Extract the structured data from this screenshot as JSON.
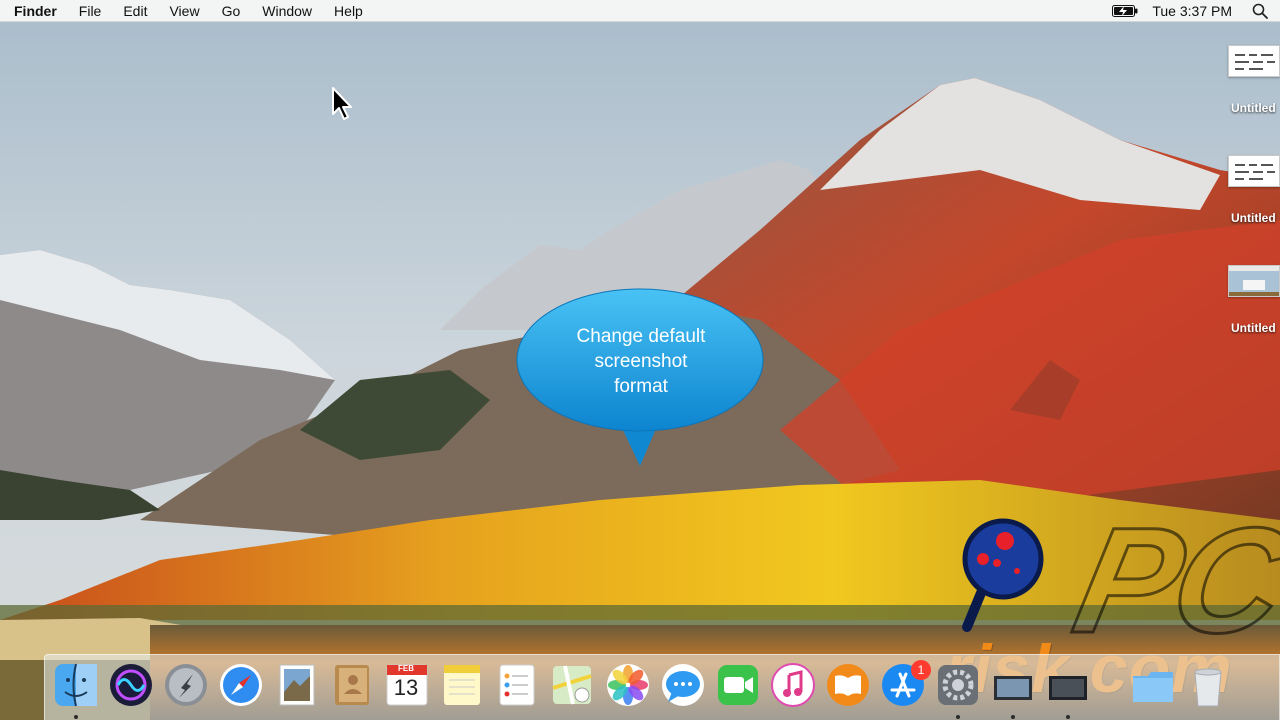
{
  "menubar": {
    "app_name": "Finder",
    "menus": [
      "File",
      "Edit",
      "View",
      "Go",
      "Window",
      "Help"
    ],
    "clock": "Tue 3:37 PM",
    "icons": [
      "battery-charging-icon",
      "spotlight-search-icon"
    ]
  },
  "desktop": {
    "files": [
      {
        "name": "Untitled"
      },
      {
        "name": "Untitled"
      },
      {
        "name": "Untitled"
      }
    ]
  },
  "callout": {
    "lines": [
      "Change default",
      "screenshot",
      "format"
    ],
    "color": "#1ea0e6"
  },
  "dock": {
    "items": [
      "finder",
      "siri",
      "launchpad",
      "safari",
      "mail",
      "contacts",
      "calendar",
      "notes",
      "reminders",
      "maps",
      "photos",
      "messages",
      "facetime",
      "itunes",
      "ibooks",
      "app-store",
      "system-preferences",
      "screenshot-1",
      "screenshot-2",
      "downloads",
      "trash"
    ],
    "calendar": {
      "month": "FEB",
      "day": "13"
    },
    "app_store_badge": "1"
  },
  "watermark": {
    "text_top": "PC",
    "text_bottom": "risk.com",
    "accent": "#f28a18"
  }
}
